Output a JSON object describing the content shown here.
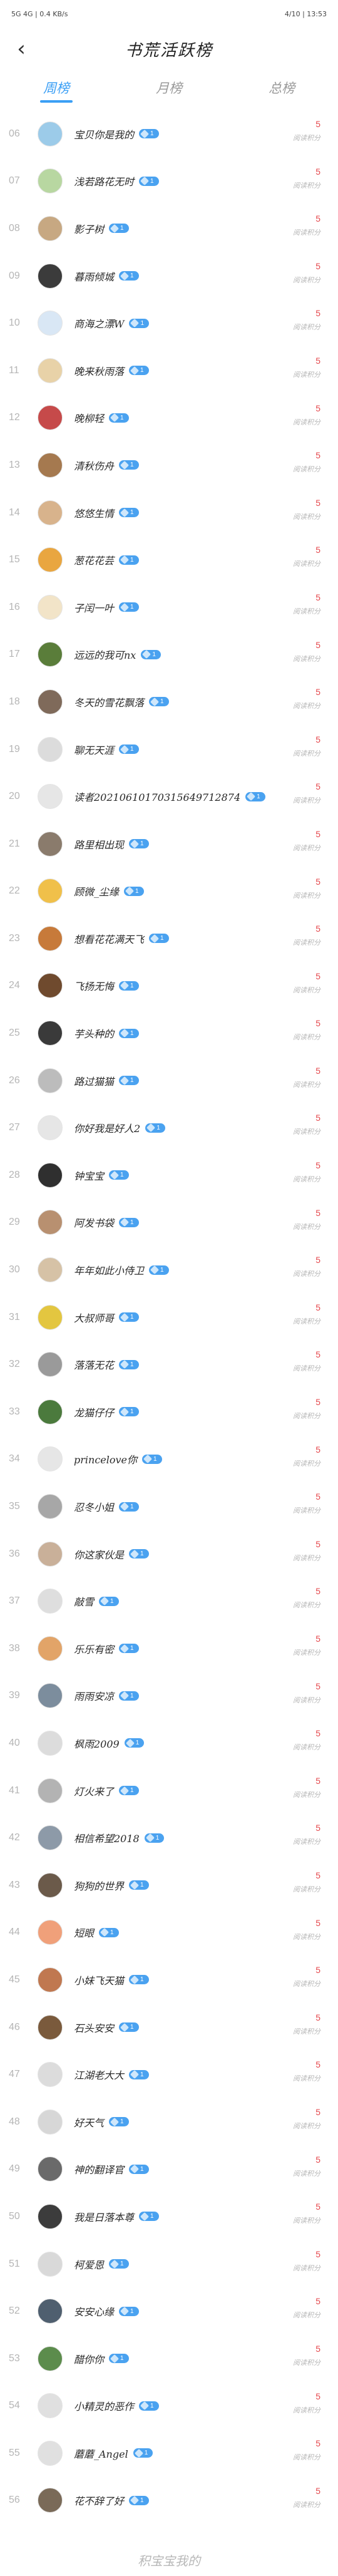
{
  "status_bar": {
    "left": "5G 4G | 0.4 KB/s",
    "right": "4/10 | 13:53"
  },
  "header": {
    "back_icon": "chevron-left-icon",
    "title": "书荒活跃榜"
  },
  "tabs": [
    {
      "label": "周榜",
      "active": true
    },
    {
      "label": "月榜",
      "active": false
    },
    {
      "label": "总榜",
      "active": false
    }
  ],
  "score_unit": "阅读积分",
  "score_value": "5",
  "badge_label": "1",
  "rows": [
    {
      "rank": "06",
      "name": "宝贝你是我的",
      "avatar_color": "#9ccbe9"
    },
    {
      "rank": "07",
      "name": "浅若路花无时",
      "avatar_color": "#b8d7a1"
    },
    {
      "rank": "08",
      "name": "影子树",
      "avatar_color": "#c7a882"
    },
    {
      "rank": "09",
      "name": "暮雨倾城",
      "avatar_color": "#3b3b3b"
    },
    {
      "rank": "10",
      "name": "商海之漂W",
      "avatar_color": "#d9e7f5"
    },
    {
      "rank": "11",
      "name": "晚来秋雨落",
      "avatar_color": "#e8d2a8"
    },
    {
      "rank": "12",
      "name": "晚柳轻",
      "avatar_color": "#c64a4a"
    },
    {
      "rank": "13",
      "name": "清秋伤舟",
      "avatar_color": "#a5794f"
    },
    {
      "rank": "14",
      "name": "悠悠生情",
      "avatar_color": "#d8b38c"
    },
    {
      "rank": "15",
      "name": "葱花花芸",
      "avatar_color": "#e9a640"
    },
    {
      "rank": "16",
      "name": "子闰一叶",
      "avatar_color": "#f2e4c8"
    },
    {
      "rank": "17",
      "name": "远远的我可nx",
      "avatar_color": "#5a7d3a"
    },
    {
      "rank": "18",
      "name": "冬天的雪花飘落",
      "avatar_color": "#7f6a5a"
    },
    {
      "rank": "19",
      "name": "聊无天涯",
      "avatar_color": "#dcdcdc"
    },
    {
      "rank": "20",
      "name": "读者20210610170315649712874",
      "avatar_color": "#e6e6e6"
    },
    {
      "rank": "21",
      "name": "路里相出现",
      "avatar_color": "#8a7b6c"
    },
    {
      "rank": "22",
      "name": "顾微_尘缘",
      "avatar_color": "#f0c04a"
    },
    {
      "rank": "23",
      "name": "想看花花满天飞",
      "avatar_color": "#c77a3a"
    },
    {
      "rank": "24",
      "name": "飞扬无悔",
      "avatar_color": "#6f4a2e"
    },
    {
      "rank": "25",
      "name": "芋头种的",
      "avatar_color": "#3a3a3a"
    },
    {
      "rank": "26",
      "name": "路过猫猫",
      "avatar_color": "#bcbcbc"
    },
    {
      "rank": "27",
      "name": "你好我是好人2",
      "avatar_color": "#e6e6e6"
    },
    {
      "rank": "28",
      "name": "钟宝宝",
      "avatar_color": "#2f2f2f"
    },
    {
      "rank": "29",
      "name": "阿发书袋",
      "avatar_color": "#b89070"
    },
    {
      "rank": "30",
      "name": "年年如此小侍卫",
      "avatar_color": "#d6c2a6"
    },
    {
      "rank": "31",
      "name": "大叔师哥",
      "avatar_color": "#e3c640"
    },
    {
      "rank": "32",
      "name": "落落无花",
      "avatar_color": "#9a9a9a"
    },
    {
      "rank": "33",
      "name": "龙猫仔仔",
      "avatar_color": "#4b7a3d"
    },
    {
      "rank": "34",
      "name": "princelove你",
      "avatar_color": "#e6e6e6"
    },
    {
      "rank": "35",
      "name": "忍冬小姐",
      "avatar_color": "#a7a7a7"
    },
    {
      "rank": "36",
      "name": "你这家伙是",
      "avatar_color": "#c9b099"
    },
    {
      "rank": "37",
      "name": "敲雪",
      "avatar_color": "#dedede"
    },
    {
      "rank": "38",
      "name": "乐乐有密",
      "avatar_color": "#e2a468"
    },
    {
      "rank": "39",
      "name": "雨雨安凉",
      "avatar_color": "#7c8d9d"
    },
    {
      "rank": "40",
      "name": "枫雨2009",
      "avatar_color": "#dcdcdc"
    },
    {
      "rank": "41",
      "name": "灯火来了",
      "avatar_color": "#b3b3b3"
    },
    {
      "rank": "42",
      "name": "相信希望2018",
      "avatar_color": "#8d9aa8"
    },
    {
      "rank": "43",
      "name": "狗狗的世界",
      "avatar_color": "#6b5a4a"
    },
    {
      "rank": "44",
      "name": "短眼",
      "avatar_color": "#f0a07a"
    },
    {
      "rank": "45",
      "name": "小妹飞天猫",
      "avatar_color": "#c07850"
    },
    {
      "rank": "46",
      "name": "石头安安",
      "avatar_color": "#7a5a3c"
    },
    {
      "rank": "47",
      "name": "江湖老大大",
      "avatar_color": "#dcdcdc"
    },
    {
      "rank": "48",
      "name": "好天气",
      "avatar_color": "#d7d7d7"
    },
    {
      "rank": "49",
      "name": "神的翻译官",
      "avatar_color": "#6a6a6a"
    },
    {
      "rank": "50",
      "name": "我是日落本尊",
      "avatar_color": "#3c3c3c"
    },
    {
      "rank": "51",
      "name": "柯爱恩",
      "avatar_color": "#d9d9d9"
    },
    {
      "rank": "52",
      "name": "安安心缘",
      "avatar_color": "#4f5f6f"
    },
    {
      "rank": "53",
      "name": "醋你你",
      "avatar_color": "#5c8c4c"
    },
    {
      "rank": "54",
      "name": "小精灵的恶作",
      "avatar_color": "#e0e0e0"
    },
    {
      "rank": "55",
      "name": "蘑蘑_Angel",
      "avatar_color": "#e0e0e0"
    },
    {
      "rank": "56",
      "name": "花不辞了好",
      "avatar_color": "#7a6a58"
    }
  ],
  "footer": "积宝宝我的"
}
